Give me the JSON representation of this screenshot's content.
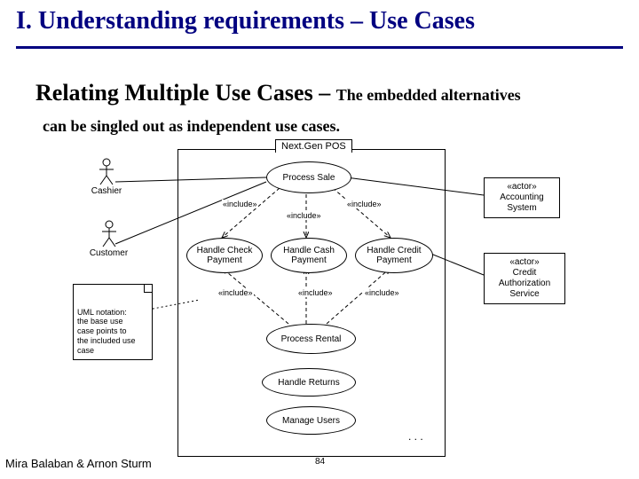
{
  "title": "I. Understanding requirements – Use Cases",
  "subtitle_bold": "Relating Multiple Use Cases – ",
  "subtitle_tail": "The embedded alternatives",
  "subtitle_line2": "can be singled out as independent use cases.",
  "footer": "Mira Balaban  &  Arnon Sturm",
  "page_number": "84",
  "diagram": {
    "system_label": "Next.Gen POS",
    "actors": {
      "cashier": "Cashier",
      "customer": "Customer"
    },
    "external_actors": {
      "accounting": {
        "stereo": "«actor»",
        "name": "Accounting\nSystem"
      },
      "credit_auth": {
        "stereo": "«actor»",
        "name": "Credit\nAuthorization\nService"
      }
    },
    "usecases": {
      "process_sale": "Process Sale",
      "handle_check": "Handle Check\nPayment",
      "handle_cash": "Handle Cash\nPayment",
      "handle_credit": "Handle Credit\nPayment",
      "process_rental": "Process Rental",
      "handle_returns": "Handle Returns",
      "manage_users": "Manage Users"
    },
    "include_label": "«include»",
    "note": "UML notation:\nthe base use\ncase points to\nthe included use\ncase",
    "ellipsis": ". . ."
  }
}
